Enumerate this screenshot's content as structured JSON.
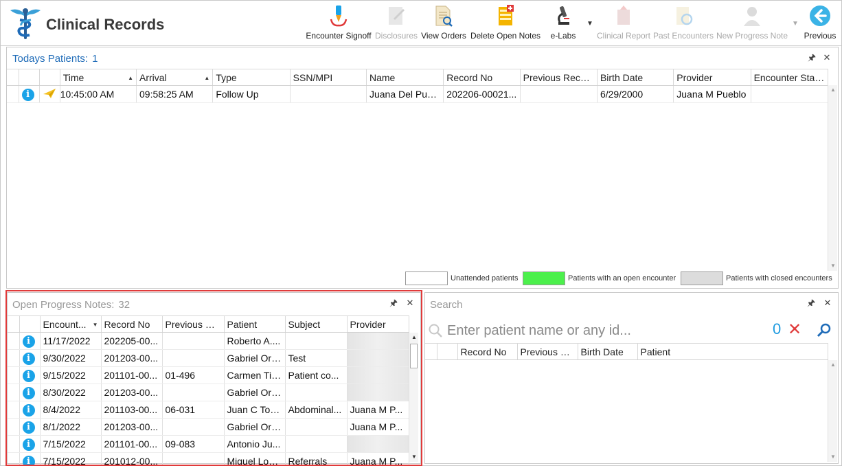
{
  "app": {
    "title": "Clinical Records",
    "colors": {
      "accent": "#1e6bb8",
      "info": "#1aa3e8",
      "open_encounter": "#4cf04c",
      "closed_encounter": "#dcdcdc",
      "highlight": "#e03a3a"
    }
  },
  "toolbar": {
    "encounter_signoff": "Encounter Signoff",
    "disclosures": "Disclosures",
    "view_orders": "View Orders",
    "delete_open_notes": "Delete Open Notes",
    "e_labs": "e-Labs",
    "clinical_report": "Clinical Report",
    "past_encounters": "Past Encounters",
    "new_progress_note": "New Progress Note",
    "previous": "Previous"
  },
  "todays_patients": {
    "title": "Todays Patients:",
    "count": "1",
    "columns": [
      "Time",
      "Arrival",
      "Type",
      "SSN/MPI",
      "Name",
      "Record No",
      "Previous Recor...",
      "Birth Date",
      "Provider",
      "Encounter Stat..."
    ],
    "rows": [
      {
        "time": "10:45:00 AM",
        "arrival": "09:58:25 AM",
        "type": "Follow Up",
        "ssn": "",
        "name": "Juana Del Pue...",
        "record_no": "202206-00021...",
        "previous_record": "",
        "birth_date": "6/29/2000",
        "provider": "Juana M Pueblo",
        "encounter_status": ""
      }
    ],
    "legend": {
      "unattended": "Unattended patients",
      "open": "Patients with an open encounter",
      "closed": "Patients with closed encounters"
    }
  },
  "open_notes": {
    "title": "Open Progress Notes:",
    "count": "32",
    "columns": [
      "Encount...",
      "Record No",
      "Previous Re...",
      "Patient",
      "Subject",
      "Provider"
    ],
    "rows": [
      {
        "date": "11/17/2022",
        "record_no": "202205-00...",
        "previous": "",
        "patient": "Roberto A....",
        "subject": "",
        "provider": ""
      },
      {
        "date": "9/30/2022",
        "record_no": "201203-00...",
        "previous": "",
        "patient": "Gabriel Ort...",
        "subject": "Test",
        "provider": ""
      },
      {
        "date": "9/15/2022",
        "record_no": "201101-00...",
        "previous": "01-496",
        "patient": "Carmen Tir...",
        "subject": "Patient co...",
        "provider": ""
      },
      {
        "date": "8/30/2022",
        "record_no": "201203-00...",
        "previous": "",
        "patient": "Gabriel Ort...",
        "subject": "",
        "provider": ""
      },
      {
        "date": "8/4/2022",
        "record_no": "201103-00...",
        "previous": "06-031",
        "patient": "Juan C Torr...",
        "subject": "Abdominal...",
        "provider": "Juana M P..."
      },
      {
        "date": "8/1/2022",
        "record_no": "201203-00...",
        "previous": "",
        "patient": "Gabriel Ort...",
        "subject": "",
        "provider": "Juana M P..."
      },
      {
        "date": "7/15/2022",
        "record_no": "201101-00...",
        "previous": "09-083",
        "patient": "Antonio Ju...",
        "subject": "",
        "provider": ""
      },
      {
        "date": "7/15/2022",
        "record_no": "201012-00...",
        "previous": "",
        "patient": "Miguel Lop...",
        "subject": "Referrals",
        "provider": "Juana M P..."
      }
    ]
  },
  "search": {
    "title": "Search",
    "placeholder": "Enter patient name or any id...",
    "result_count": "0",
    "columns": [
      "Record No",
      "Previous R...",
      "Birth Date",
      "Patient"
    ]
  }
}
